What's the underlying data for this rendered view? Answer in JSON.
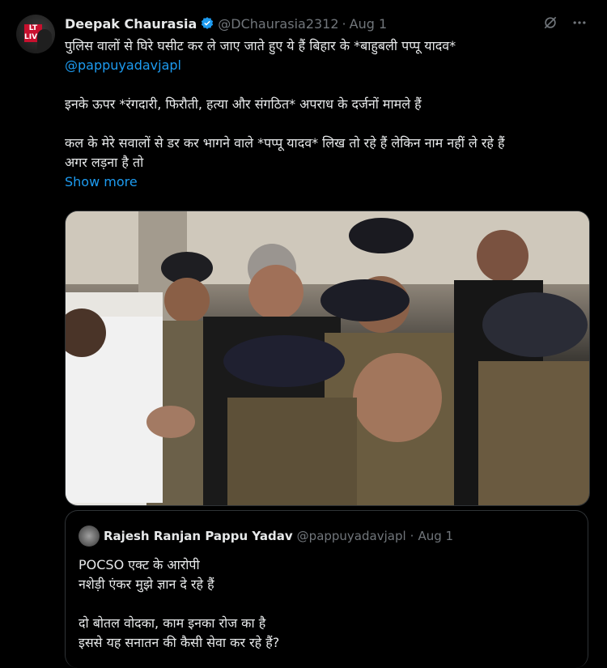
{
  "tweet": {
    "author_name": "Deepak Chaurasia",
    "handle": "@DChaurasia2312",
    "separator": "·",
    "time": "Aug 1",
    "avatar_text": "LT LIVE TIMES",
    "line1": "पुलिस वालों से घिरे घसीट कर ले जाए जाते हुए ये हैं बिहार के *बाहुबली पप्पू यादव*",
    "mention": "@pappuyadavjapl",
    "line2": "इनके ऊपर *रंगदारी, फिरौती, हत्या और संगठित* अपराध के दर्जनों मामले हैं",
    "line3a": "कल के मेरे सवालों से डर कर भागने वाले *पप्पू यादव* लिख तो रहे हैं लेकिन नाम नहीं ले रहे हैं",
    "line3b": "अगर लड़ना है तो",
    "show_more": "Show more"
  },
  "quote": {
    "author_name": "Rajesh Ranjan Pappu Yadav",
    "handle": "@pappuyadavjapl",
    "separator": "·",
    "time": "Aug 1",
    "line1": "POCSO एक्ट के आरोपी",
    "line2": "नशेड़ी एंकर मुझे ज्ञान दे रहे हैं",
    "line3": "दो बोतल वोदका, काम इनका रोज का है",
    "line4": "इससे यह सनातन की कैसी सेवा कर रहे हैं?"
  },
  "icons": {
    "verified": "verified-badge-icon",
    "grok": "grok-icon",
    "more": "more-icon"
  },
  "colors": {
    "link": "#1d9bf0",
    "muted": "#71767b",
    "text": "#e7e9ea",
    "background": "#000000"
  }
}
